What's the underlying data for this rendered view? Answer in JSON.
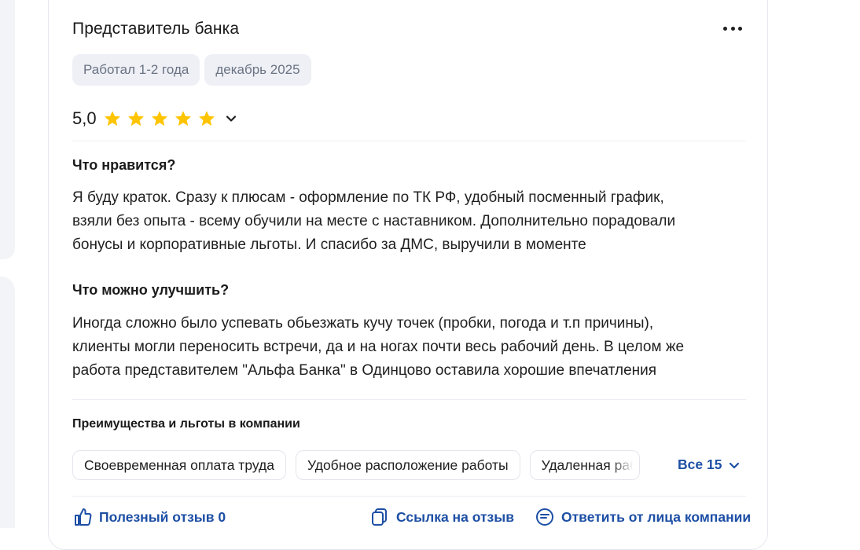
{
  "review": {
    "title": "Представитель банка",
    "chips": [
      "Работал 1-2 года",
      "декабрь 2025"
    ],
    "rating": "5,0",
    "rating_stars": 5,
    "sections": [
      {
        "heading": "Что нравится?",
        "lines": [
          "Я буду краток. Сразу к плюсам - оформление по ТК РФ, удобный посменный график,",
          "взяли без опыта - всему обучили на месте с наставником. Дополнительно порадовали",
          "бонусы и корпоративные льготы. И спасибо за ДМС, выручили в моменте"
        ]
      },
      {
        "heading": "Что можно улучшить?",
        "lines": [
          "Иногда сложно было успевать обьезжать кучу точек (пробки, погода и т.п причины),",
          "клиенты могли переносить встречи, да и на ногах почти весь рабочий день. В целом же",
          "работа представителем \"Альфа Банка\" в Одинцово оставила хорошие впечатления"
        ]
      }
    ],
    "benefits": {
      "title": "Преимущества и льготы в компании",
      "items": [
        "Своевременная оплата труда",
        "Удобное расположение работы",
        "Удаленная работа"
      ],
      "all_label": "Все 15"
    },
    "actions": {
      "helpful": "Полезный отзыв 0",
      "link": "Ссылка на отзыв",
      "reply": "Ответить от лица компании"
    }
  },
  "colors": {
    "accent": "#1d4fa5",
    "star": "#ffc400",
    "chip_bg": "#eef0f6"
  }
}
